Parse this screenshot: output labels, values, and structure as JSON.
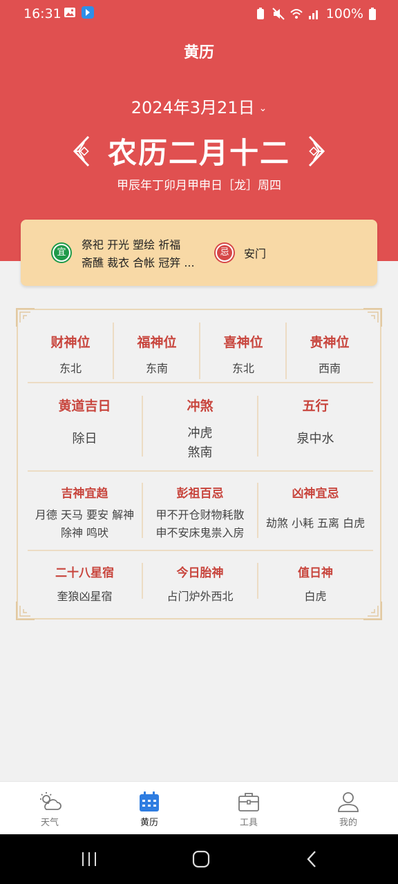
{
  "status_bar": {
    "time": "16:31",
    "battery": "100%"
  },
  "app": {
    "title": "黄历"
  },
  "date": {
    "solar": "2024年3月21日",
    "lunar": "农历二月十二",
    "ganzhi": "甲辰年丁卯月甲申日［龙］周四"
  },
  "yiji": {
    "yi_badge": "宜",
    "yi_line1": "祭祀 开光 塑绘 祈福",
    "yi_line2": "斋醮 裁衣 合帐 冠笄 ...",
    "ji_badge": "忌",
    "ji_text": "安门"
  },
  "gods": [
    {
      "label": "财神位",
      "value": "东北"
    },
    {
      "label": "福神位",
      "value": "东南"
    },
    {
      "label": "喜神位",
      "value": "东北"
    },
    {
      "label": "贵神位",
      "value": "西南"
    }
  ],
  "day_info": [
    {
      "label": "黄道吉日",
      "value": "除日",
      "value2": ""
    },
    {
      "label": "冲煞",
      "value": "冲虎",
      "value2": "煞南"
    },
    {
      "label": "五行",
      "value": "泉中水",
      "value2": ""
    }
  ],
  "spirits": [
    {
      "label": "吉神宜趋",
      "line1": "月德 天马 要安 解神",
      "line2": "除神 鸣吠"
    },
    {
      "label": "彭祖百忌",
      "line1": "甲不开仓财物耗散",
      "line2": "申不安床鬼祟入房"
    },
    {
      "label": "凶神宜忌",
      "line1": "劫煞 小耗 五离 白虎",
      "line2": ""
    }
  ],
  "misc": [
    {
      "label": "二十八星宿",
      "value": "奎狼凶星宿"
    },
    {
      "label": "今日胎神",
      "value": "占门炉外西北"
    },
    {
      "label": "值日神",
      "value": "白虎"
    }
  ],
  "bottom_nav": [
    {
      "label": "天气",
      "icon": "weather-icon"
    },
    {
      "label": "黄历",
      "icon": "calendar-icon"
    },
    {
      "label": "工具",
      "icon": "toolbox-icon"
    },
    {
      "label": "我的",
      "icon": "user-icon"
    }
  ],
  "colors": {
    "header_red": "#e05050",
    "label_red": "#c8453d",
    "card_gold": "#f8d9a6",
    "active_blue": "#2f7de1"
  }
}
